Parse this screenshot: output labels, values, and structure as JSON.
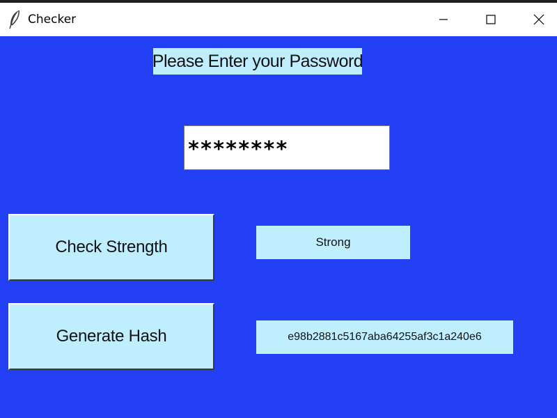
{
  "window": {
    "title": "Checker",
    "icon": "feather-icon",
    "controls": {
      "minimize": "minimize-icon",
      "maximize": "maximize-icon",
      "close": "close-icon"
    }
  },
  "form": {
    "prompt_label": "Please Enter your Password",
    "password_value": "********"
  },
  "actions": {
    "check_strength_label": "Check Strength",
    "generate_hash_label": "Generate Hash"
  },
  "results": {
    "strength": "Strong",
    "hash": "e98b2881c5167aba64255af3c1a240e6"
  },
  "colors": {
    "background": "#2440f5",
    "widget": "#bfeeff",
    "entry": "#ffffff"
  }
}
